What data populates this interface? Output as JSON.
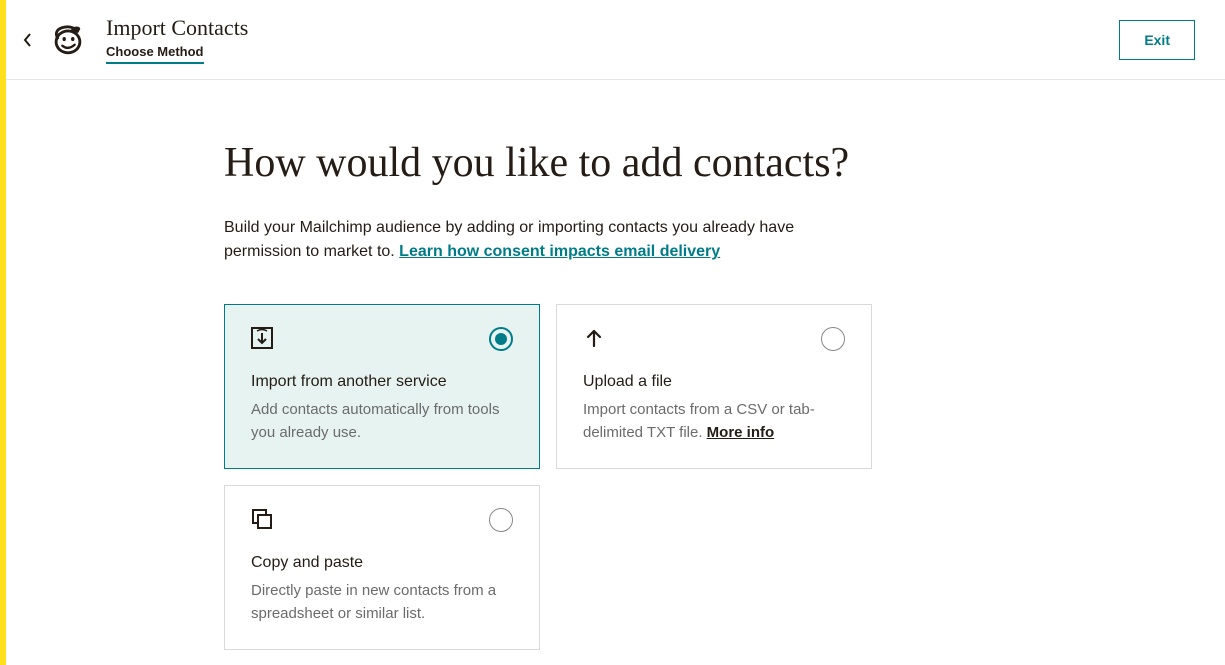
{
  "header": {
    "title": "Import Contacts",
    "subtitle": "Choose Method",
    "exit_label": "Exit"
  },
  "main": {
    "heading": "How would you like to add contacts?",
    "description_prefix": "Build your Mailchimp audience by adding or importing contacts you already have permission to market to. ",
    "consent_link_label": "Learn how consent impacts email delivery"
  },
  "cards": [
    {
      "title": "Import from another service",
      "description": "Add contacts automatically from tools you already use.",
      "selected": true,
      "icon": "import-service-icon",
      "more_info": null
    },
    {
      "title": "Upload a file",
      "description": "Import contacts from a CSV or tab-delimited TXT file. ",
      "selected": false,
      "icon": "upload-icon",
      "more_info": "More info"
    },
    {
      "title": "Copy and paste",
      "description": "Directly paste in new contacts from a spreadsheet or similar list.",
      "selected": false,
      "icon": "copy-paste-icon",
      "more_info": null
    }
  ]
}
